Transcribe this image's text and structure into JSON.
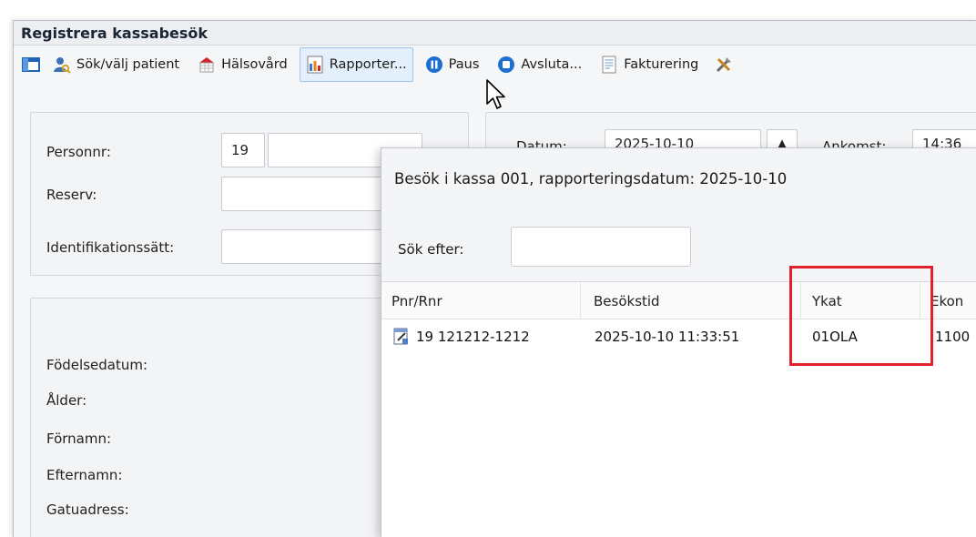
{
  "window": {
    "title": "Registrera kassabesök"
  },
  "toolbar": {
    "search_patient": "Sök/välj patient",
    "halsovard": "Hälsovård",
    "rapporter": "Rapporter...",
    "paus": "Paus",
    "avsluta": "Avsluta...",
    "fakturering": "Fakturering"
  },
  "form": {
    "personnr_label": "Personnr:",
    "personnr_value": "19",
    "reserv_label": "Reserv:",
    "ident_label": "Identifikationssätt:",
    "fodelsedatum_label": "Födelsedatum:",
    "alder_label": "Ålder:",
    "fornamn_label": "Förnamn:",
    "efternamn_label": "Efternamn:",
    "gatuadress_label": "Gatuadress:",
    "datum_label": "Datum:",
    "datum_value": "2025-10-10",
    "ankomst_label": "Ankomst:",
    "ankomst_value": "14:36"
  },
  "popup": {
    "title": "Besök i kassa 001,  rapporteringsdatum: 2025-10-10",
    "search_label": "Sök efter:",
    "search_value": "",
    "columns": [
      "Pnr/Rnr",
      "Besökstid",
      "Ykat",
      "Ekon"
    ],
    "rows": [
      {
        "pnr": "19  121212-1212",
        "besokstid": "2025-10-10 11:33:51",
        "ykat": "01OLA",
        "ekon": "1100"
      }
    ]
  },
  "colors": {
    "highlight": "#e0202a",
    "hover_bg": "#e3effb",
    "hover_border": "#9ec4ec"
  },
  "icons": [
    "layout-icon",
    "user-search-icon",
    "calendar-icon",
    "report-icon",
    "pause-icon",
    "stop-icon",
    "invoice-icon",
    "tools-icon",
    "document-icon",
    "mouse-cursor-icon"
  ]
}
